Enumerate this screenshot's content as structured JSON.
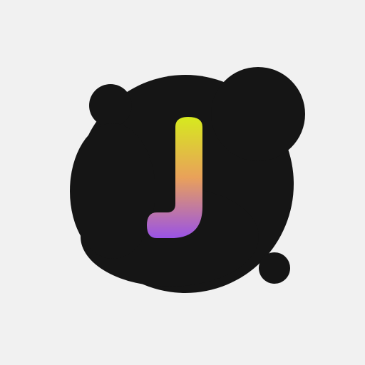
{
  "app_icon": {
    "icon": "letter-j-blob-logo-icon",
    "colors": {
      "background": "#f1f1f1",
      "blob": "#151515",
      "gradient_top": "#d6ea1e",
      "gradient_mid": "#e9a15a",
      "gradient_bottom": "#9a53e6"
    }
  }
}
